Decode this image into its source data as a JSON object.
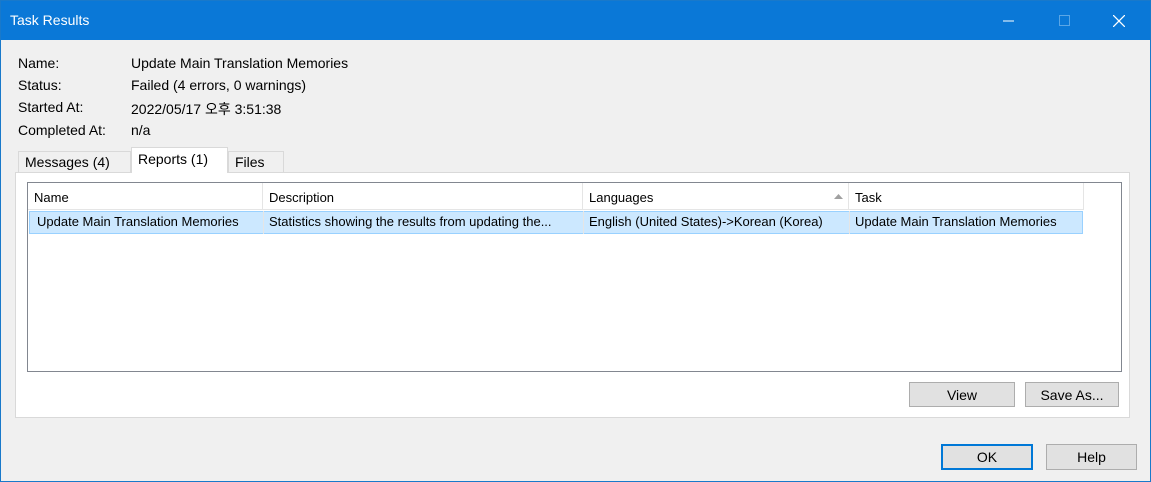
{
  "window": {
    "title": "Task Results"
  },
  "info": {
    "name_label": "Name:",
    "name_value": "Update Main Translation Memories",
    "status_label": "Status:",
    "status_value": "Failed (4 errors, 0 warnings)",
    "started_label": "Started At:",
    "started_value": "2022/05/17 오후 3:51:38",
    "completed_label": "Completed At:",
    "completed_value": "n/a"
  },
  "tabs": [
    {
      "label": "Messages (4)"
    },
    {
      "label": "Reports (1)",
      "active": true
    },
    {
      "label": "Files"
    }
  ],
  "table": {
    "columns": [
      "Name",
      "Description",
      "Languages",
      "Task"
    ],
    "sorted_column": "Languages",
    "rows": [
      [
        "Update Main Translation Memories",
        "Statistics showing the results from updating the...",
        "English (United States)->Korean (Korea)",
        "Update Main Translation Memories"
      ]
    ]
  },
  "panel_buttons": {
    "view": "View",
    "save_as": "Save As..."
  },
  "footer_buttons": {
    "ok": "OK",
    "help": "Help"
  }
}
